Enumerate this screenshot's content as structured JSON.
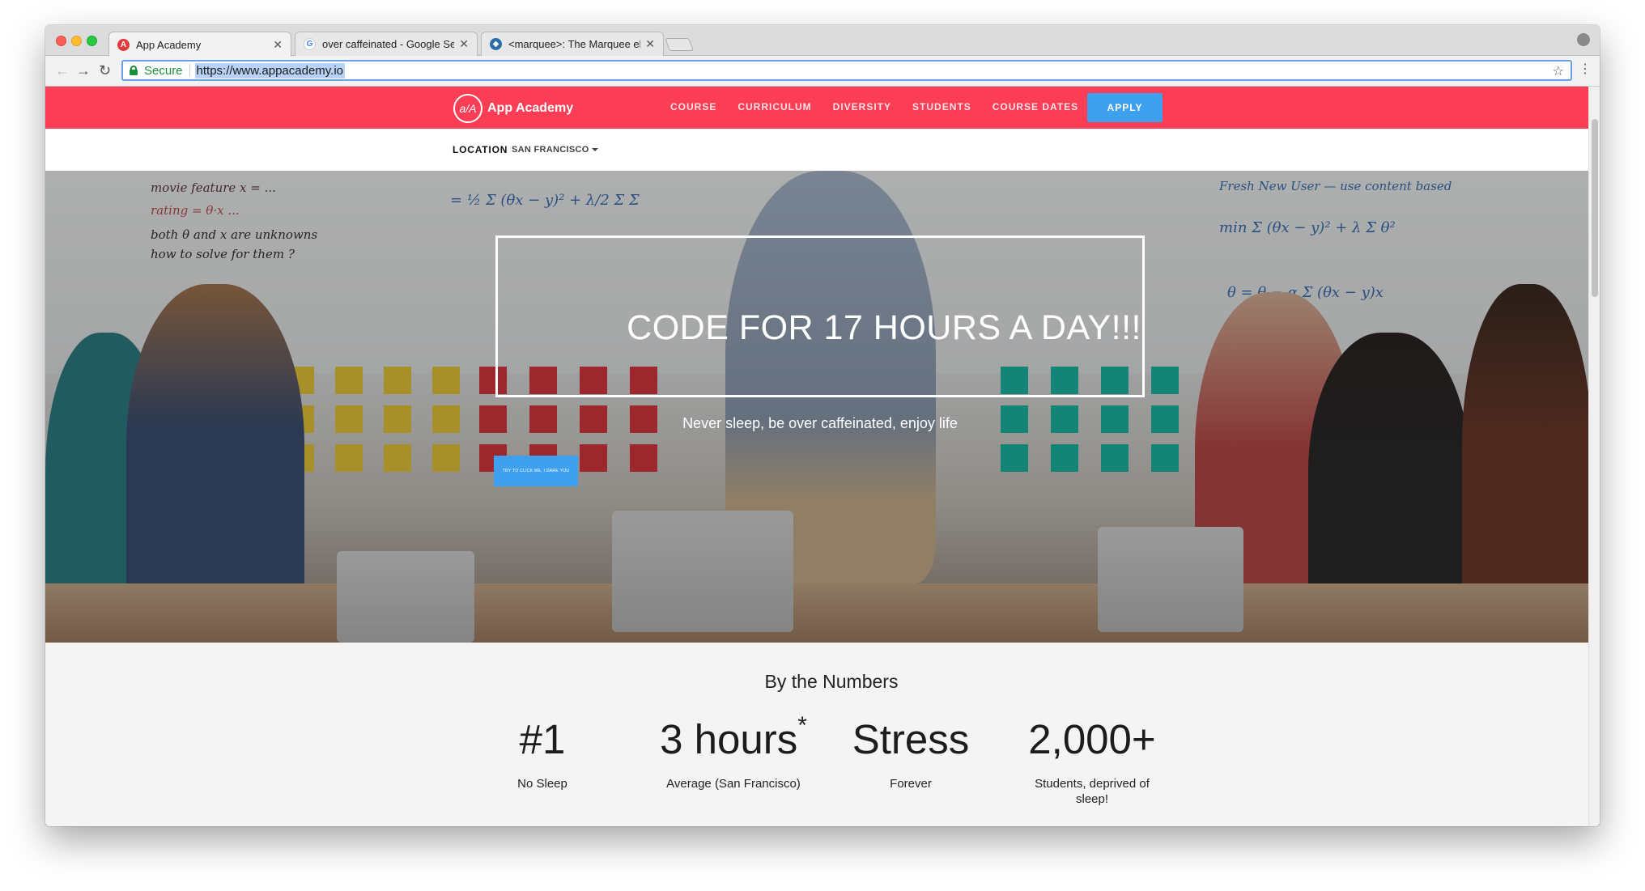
{
  "browser": {
    "tabs": [
      {
        "title": "App Academy",
        "active": true
      },
      {
        "title": "over caffeinated - Google Sea",
        "active": false
      },
      {
        "title": "<marquee>: The Marquee elem",
        "active": false
      }
    ],
    "address": {
      "secure_label": "Secure",
      "url": "https://www.appacademy.io"
    }
  },
  "site": {
    "logo_mark": "a/A",
    "logo_text": "App Academy",
    "nav": [
      "COURSE",
      "CURRICULUM",
      "DIVERSITY",
      "STUDENTS",
      "COURSE DATES"
    ],
    "apply_label": "APPLY",
    "location_label": "LOCATION",
    "location_value": "SAN FRANCISCO",
    "accent_color": "#fb3e55",
    "button_color": "#3fa0ef"
  },
  "hero": {
    "title": "CODE FOR 17 HOURS A DAY!!!",
    "subtitle": "Never sleep, be over caffeinated, enjoy life",
    "cta_label": "TRY TO CLICK ME, I DARE YOU"
  },
  "numbers": {
    "heading": "By the Numbers",
    "stats": [
      {
        "value": "#1",
        "sup": "",
        "label": "No Sleep"
      },
      {
        "value": "3 hours",
        "sup": "*",
        "label": "Average (San Francisco)"
      },
      {
        "value": "Stress",
        "sup": "",
        "label": "Forever"
      },
      {
        "value": "2,000+",
        "sup": "",
        "label": "Students, deprived of sleep!"
      }
    ]
  }
}
